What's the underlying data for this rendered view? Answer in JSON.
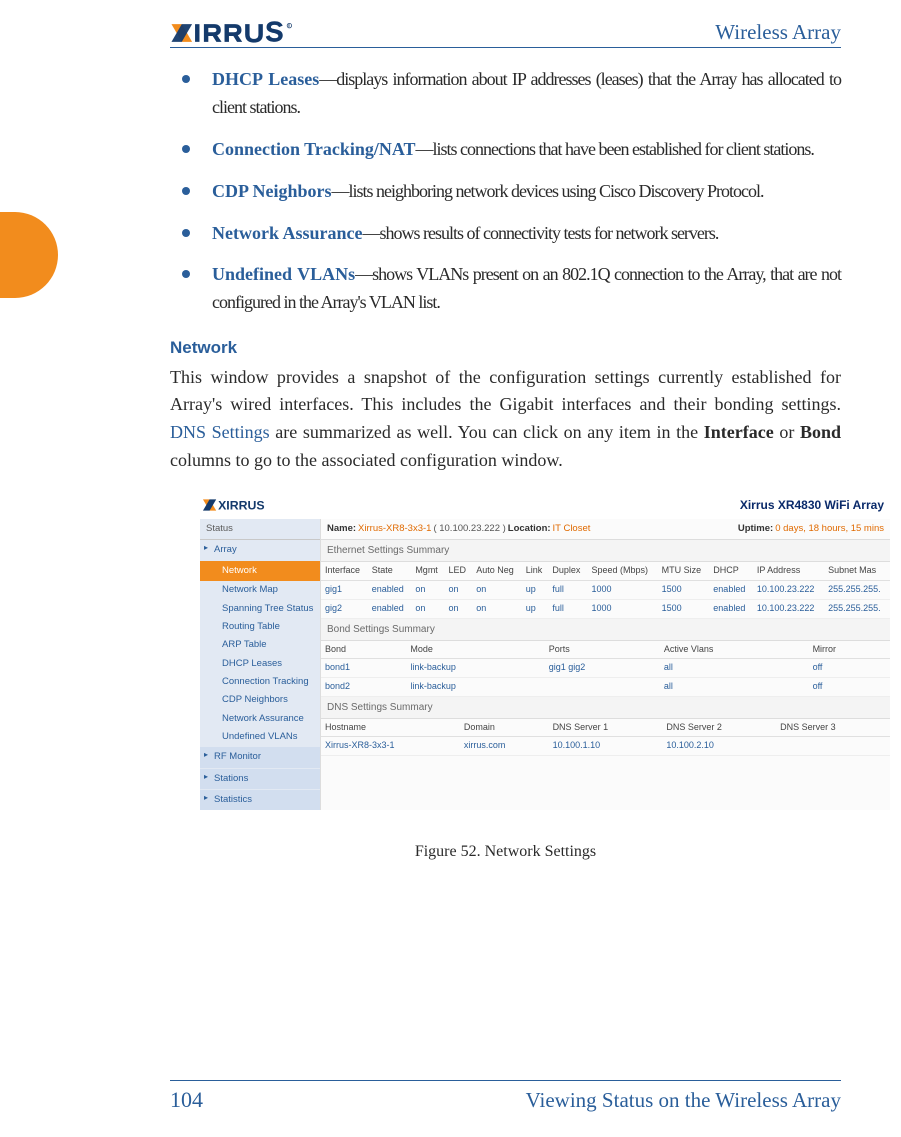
{
  "header": {
    "doc_title": "Wireless Array"
  },
  "bullets": [
    {
      "term": "DHCP Leases",
      "desc": "—displays information about IP addresses (leases) that the Array has allocated to client stations."
    },
    {
      "term": "Connection Tracking/NAT",
      "desc": "—lists connections that have been established for client stations."
    },
    {
      "term": "CDP Neighbors",
      "desc": "—lists neighboring network devices using Cisco Discovery Protocol."
    },
    {
      "term": "Network Assurance",
      "desc": "—shows results of connectivity tests for network servers."
    },
    {
      "term": "Undefined VLANs",
      "desc": "—shows VLANs present on an 802.1Q connection to the Array, that are not configured in the Array's VLAN list."
    }
  ],
  "section": {
    "heading": "Network",
    "para_1": "This window provides a snapshot of the configuration settings currently established for Array's wired interfaces. This includes the Gigabit interfaces and their bonding settings. ",
    "link": "DNS Settings",
    "para_2": " are summarized as well. You can click on any item in the ",
    "b1": "Interface",
    "mid": " or ",
    "b2": "Bond",
    "para_3": " columns to go to the associated configuration window."
  },
  "embed": {
    "product": "Xirrus XR4830 WiFi Array",
    "info": {
      "name_label": "Name:",
      "name": "Xirrus-XR8-3x3-1",
      "ip": "( 10.100.23.222 )",
      "loc_label": "Location:",
      "loc": "IT Closet",
      "up_label": "Uptime:",
      "up": "0 days, 18 hours, 15 mins"
    },
    "sidebar": {
      "status": "Status",
      "array": "Array",
      "active": "Network",
      "items": [
        "Network Map",
        "Spanning Tree Status",
        "Routing Table",
        "ARP Table",
        "DHCP Leases",
        "Connection Tracking",
        "CDP Neighbors",
        "Network Assurance",
        "Undefined VLANs"
      ],
      "secs": [
        "RF Monitor",
        "Stations",
        "Statistics"
      ]
    },
    "eth": {
      "title": "Ethernet Settings Summary",
      "headers": [
        "Interface",
        "State",
        "Mgmt",
        "LED",
        "Auto Neg",
        "Link",
        "Duplex",
        "Speed (Mbps)",
        "MTU Size",
        "DHCP",
        "IP Address",
        "Subnet Mas"
      ],
      "rows": [
        [
          "gig1",
          "enabled",
          "on",
          "on",
          "on",
          "up",
          "full",
          "1000",
          "1500",
          "enabled",
          "10.100.23.222",
          "255.255.255."
        ],
        [
          "gig2",
          "enabled",
          "on",
          "on",
          "on",
          "up",
          "full",
          "1000",
          "1500",
          "enabled",
          "10.100.23.222",
          "255.255.255."
        ]
      ]
    },
    "bond": {
      "title": "Bond Settings Summary",
      "headers": [
        "Bond",
        "Mode",
        "Ports",
        "Active Vlans",
        "Mirror"
      ],
      "rows": [
        [
          "bond1",
          "link-backup",
          "gig1 gig2",
          "all",
          "off"
        ],
        [
          "bond2",
          "link-backup",
          "",
          "all",
          "off"
        ]
      ]
    },
    "dns": {
      "title": "DNS Settings Summary",
      "headers": [
        "Hostname",
        "Domain",
        "DNS Server 1",
        "DNS Server 2",
        "DNS Server 3"
      ],
      "row": [
        "Xirrus-XR8-3x3-1",
        "xirrus.com",
        "10.100.1.10",
        "10.100.2.10",
        ""
      ]
    }
  },
  "figure_caption": "Figure 52. Network Settings",
  "footer": {
    "page": "104",
    "title": "Viewing Status on the Wireless Array"
  }
}
